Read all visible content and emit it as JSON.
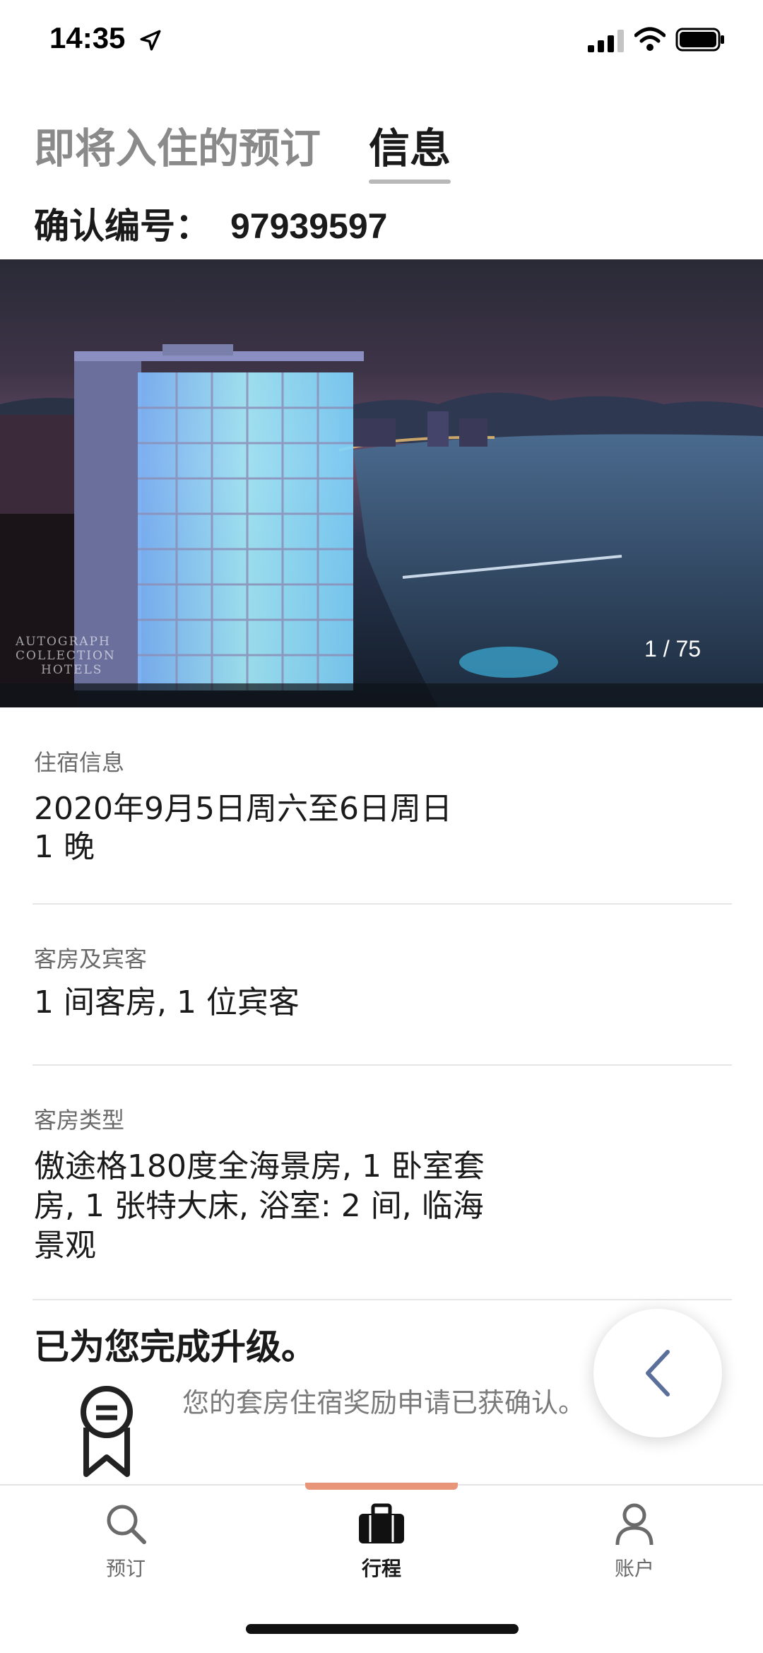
{
  "status_bar": {
    "time": "14:35"
  },
  "tabs": [
    {
      "label": "即将入住的预订"
    },
    {
      "label": "信息"
    }
  ],
  "confirmation": {
    "label": "确认编号：",
    "number": "97939597"
  },
  "hero": {
    "photo_counter": "1 / 75",
    "brand_line1": "AUTOGRAPH",
    "brand_line2": "COLLECTION",
    "brand_line3": "HOTELS"
  },
  "stay": {
    "label": "住宿信息",
    "dates": "2020年9月5日周六至6日周日",
    "nights": "1 晚"
  },
  "rooms_guests": {
    "label": "客房及宾客",
    "value": "1 间客房, 1 位宾客"
  },
  "room_type": {
    "label": "客房类型",
    "line1": "傲途格180度全海景房, 1 卧室套",
    "line2": "房, 1  张特大床, 浴室: 2 间, 临海",
    "line3": "景观"
  },
  "upgrade": {
    "title": "已为您完成升级。",
    "text": "您的套房住宿奖励申请已获确认。"
  },
  "bottom_nav": [
    {
      "label": "预订",
      "icon": "search-icon"
    },
    {
      "label": "行程",
      "icon": "briefcase-icon"
    },
    {
      "label": "账户",
      "icon": "person-icon"
    }
  ],
  "colors": {
    "nav_accent": "#e8957a",
    "fab_chevron": "#5a6f9a"
  }
}
